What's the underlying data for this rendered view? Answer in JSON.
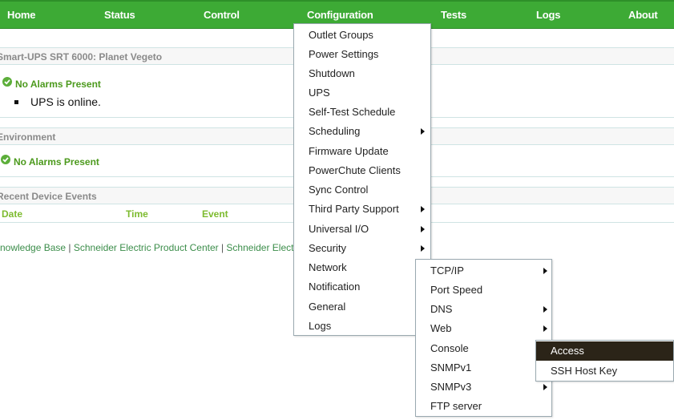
{
  "nav": {
    "home": "Home",
    "status": "Status",
    "control": "Control",
    "configuration": "Configuration",
    "tests": "Tests",
    "logs": "Logs",
    "about": "About"
  },
  "ups_section": {
    "title": "Smart-UPS SRT 6000: Planet Vegeto",
    "alarm_status": "No Alarms Present",
    "message": "UPS is online."
  },
  "environment_section": {
    "title": "Environment",
    "alarm_status": "No Alarms Present"
  },
  "events_section": {
    "title": "Recent Device Events",
    "columns": [
      "Date",
      "Time",
      "Event"
    ]
  },
  "footer": {
    "links": [
      "Knowledge Base",
      "Schneider Electric Product Center",
      "Schneider Electr"
    ]
  },
  "configuration_menu": {
    "items": [
      {
        "label": "Outlet Groups",
        "submenu": false
      },
      {
        "label": "Power Settings",
        "submenu": false
      },
      {
        "label": "Shutdown",
        "submenu": false
      },
      {
        "label": "UPS",
        "submenu": false
      },
      {
        "label": "Self-Test Schedule",
        "submenu": false
      },
      {
        "label": "Scheduling",
        "submenu": true
      },
      {
        "label": "Firmware Update",
        "submenu": false
      },
      {
        "label": "PowerChute Clients",
        "submenu": false
      },
      {
        "label": "Sync Control",
        "submenu": false
      },
      {
        "label": "Third Party Support",
        "submenu": true
      },
      {
        "label": "Universal I/O",
        "submenu": true
      },
      {
        "label": "Security",
        "submenu": true
      },
      {
        "label": "Network",
        "submenu": false
      },
      {
        "label": "Notification",
        "submenu": false
      },
      {
        "label": "General",
        "submenu": false
      },
      {
        "label": "Logs",
        "submenu": false
      }
    ]
  },
  "network_menu": {
    "items": [
      {
        "label": "TCP/IP",
        "submenu": true
      },
      {
        "label": "Port Speed",
        "submenu": false
      },
      {
        "label": "DNS",
        "submenu": true
      },
      {
        "label": "Web",
        "submenu": true
      },
      {
        "label": "Console",
        "submenu": false
      },
      {
        "label": "SNMPv1",
        "submenu": false
      },
      {
        "label": "SNMPv3",
        "submenu": true
      },
      {
        "label": "FTP server",
        "submenu": false
      }
    ]
  },
  "console_menu": {
    "items": [
      {
        "label": "Access",
        "selected": true
      },
      {
        "label": "SSH Host Key",
        "selected": false
      }
    ]
  },
  "colors": {
    "nav_bg": "#3daa35",
    "status_green": "#4c9a1d",
    "highlight_bg": "#2b2418"
  }
}
